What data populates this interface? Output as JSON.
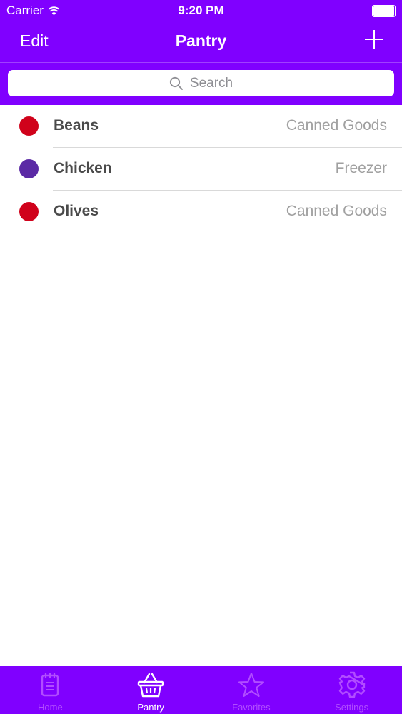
{
  "colors": {
    "accent": "#8000ff",
    "tab_inactive": "#b14dff",
    "tab_active": "#ffffff",
    "item_name": "#4a4a4a",
    "item_category": "#a0a0a0",
    "separator": "#d9d9d9"
  },
  "status_bar": {
    "carrier": "Carrier",
    "time": "9:20 PM"
  },
  "nav": {
    "edit_label": "Edit",
    "title": "Pantry",
    "add_icon": "plus-icon"
  },
  "search": {
    "placeholder": "Search",
    "icon": "search-icon"
  },
  "items": [
    {
      "name": "Beans",
      "category": "Canned Goods",
      "color": "#d0021b"
    },
    {
      "name": "Chicken",
      "category": "Freezer",
      "color": "#5b2aa5"
    },
    {
      "name": "Olives",
      "category": "Canned Goods",
      "color": "#d0021b"
    }
  ],
  "tabs": [
    {
      "label": "Home",
      "icon": "notepad-icon",
      "active": false
    },
    {
      "label": "Pantry",
      "icon": "basket-icon",
      "active": true
    },
    {
      "label": "Favorites",
      "icon": "star-icon",
      "active": false
    },
    {
      "label": "Settings",
      "icon": "gear-icon",
      "active": false
    }
  ]
}
